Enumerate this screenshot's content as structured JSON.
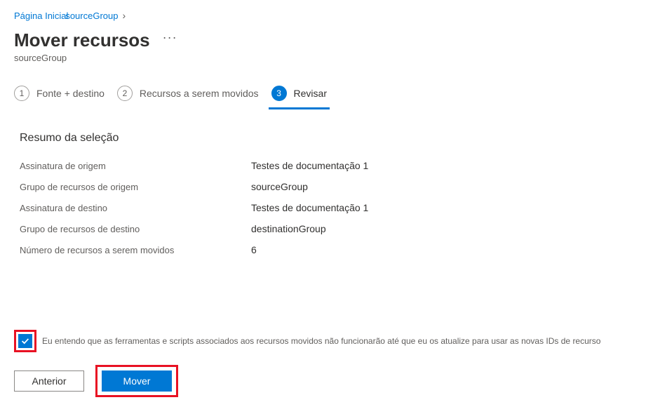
{
  "breadcrumb": {
    "home": "Página Inicial",
    "group": "sourceGroup"
  },
  "header": {
    "title": "Mover recursos",
    "subtitle": "sourceGroup"
  },
  "steps": [
    {
      "num": "1",
      "label": "Fonte +   destino"
    },
    {
      "num": "2",
      "label": "Recursos a serem movidos"
    },
    {
      "num": "3",
      "label": "Revisar"
    }
  ],
  "section_heading": "Resumo da seleção",
  "summary": {
    "rows": [
      {
        "label": "Assinatura de origem",
        "value": "Testes de documentação 1"
      },
      {
        "label": "Grupo de recursos de origem",
        "value": "sourceGroup"
      },
      {
        "label": "Assinatura de destino",
        "value": "Testes de documentação 1"
      },
      {
        "label": "Grupo de recursos de destino",
        "value": "destinationGroup"
      },
      {
        "label": "Número de recursos a serem movidos",
        "value": "6"
      }
    ]
  },
  "ack": {
    "text": "Eu entendo que as ferramentas e scripts associados aos recursos movidos não funcionarão até que eu os atualize para usar as novas IDs de recurso"
  },
  "buttons": {
    "prev": "Anterior",
    "move": "Mover"
  }
}
